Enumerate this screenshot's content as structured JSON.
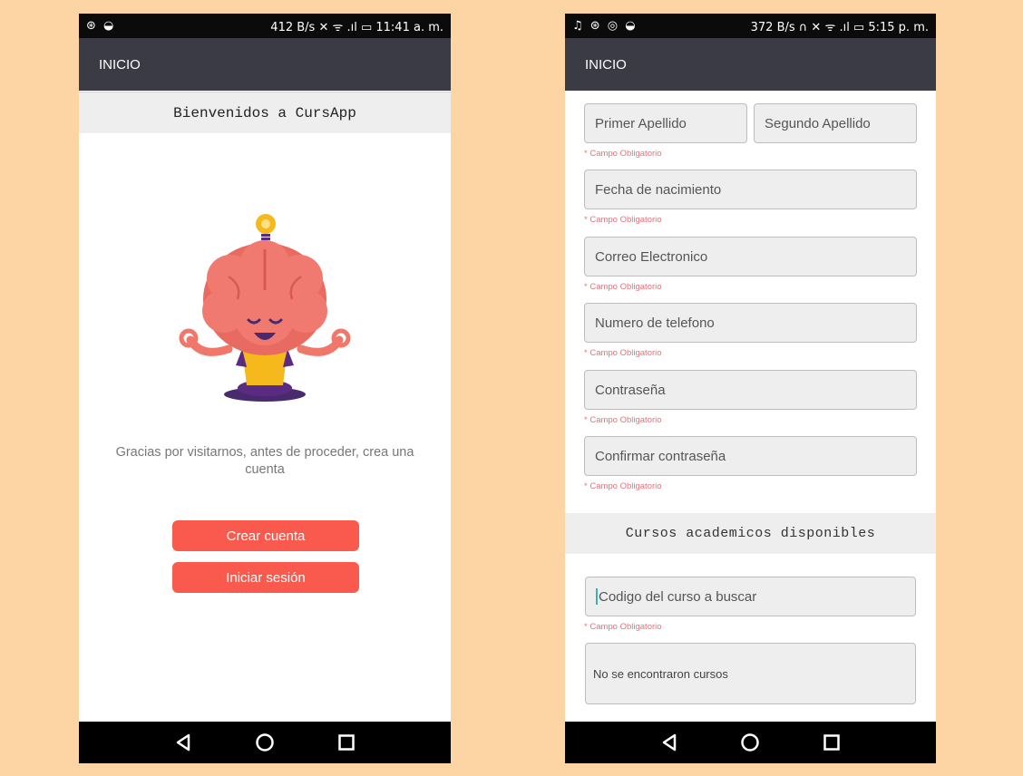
{
  "left_screen": {
    "status_left": "⊛ ◒",
    "status_right": "412 B/s ✕ ᯤ .ıl ▭ 11:41 a. m.",
    "appbar_title": "INICIO",
    "welcome_title": "Bienvenidos a CursApp",
    "intro_text": "Gracias por visitarnos, antes de proceder, crea una cuenta",
    "create_button": "Crear cuenta",
    "login_button": "Iniciar sesión"
  },
  "right_screen": {
    "status_left": "♫ ⊛ ◎ ◒",
    "status_right": "372 B/s ∩ ✕ ᯤ .ıl ▭ 5:15 p. m.",
    "appbar_title": "INICIO",
    "fields": {
      "primer_apellido": "Primer Apellido",
      "segundo_apellido": "Segundo Apellido",
      "fecha_nacimiento": "Fecha de nacimiento",
      "correo": "Correo Electronico",
      "telefono": "Numero de telefono",
      "contrasena": "Contraseña",
      "confirmar": "Confirmar contraseña",
      "codigo_curso": "Codigo del curso a buscar"
    },
    "required_label": "* Campo Obligatorio",
    "section_title": "Cursos academicos disponibles",
    "results_text": "No se encontraron cursos"
  },
  "colors": {
    "background": "#fdd5a4",
    "appbar": "#3a3b45",
    "button": "#fa5a4d",
    "required": "#e8717a"
  },
  "icons": [
    "back-icon",
    "home-icon",
    "recents-icon",
    "lightbulb-icon",
    "brain-mascot-icon"
  ]
}
